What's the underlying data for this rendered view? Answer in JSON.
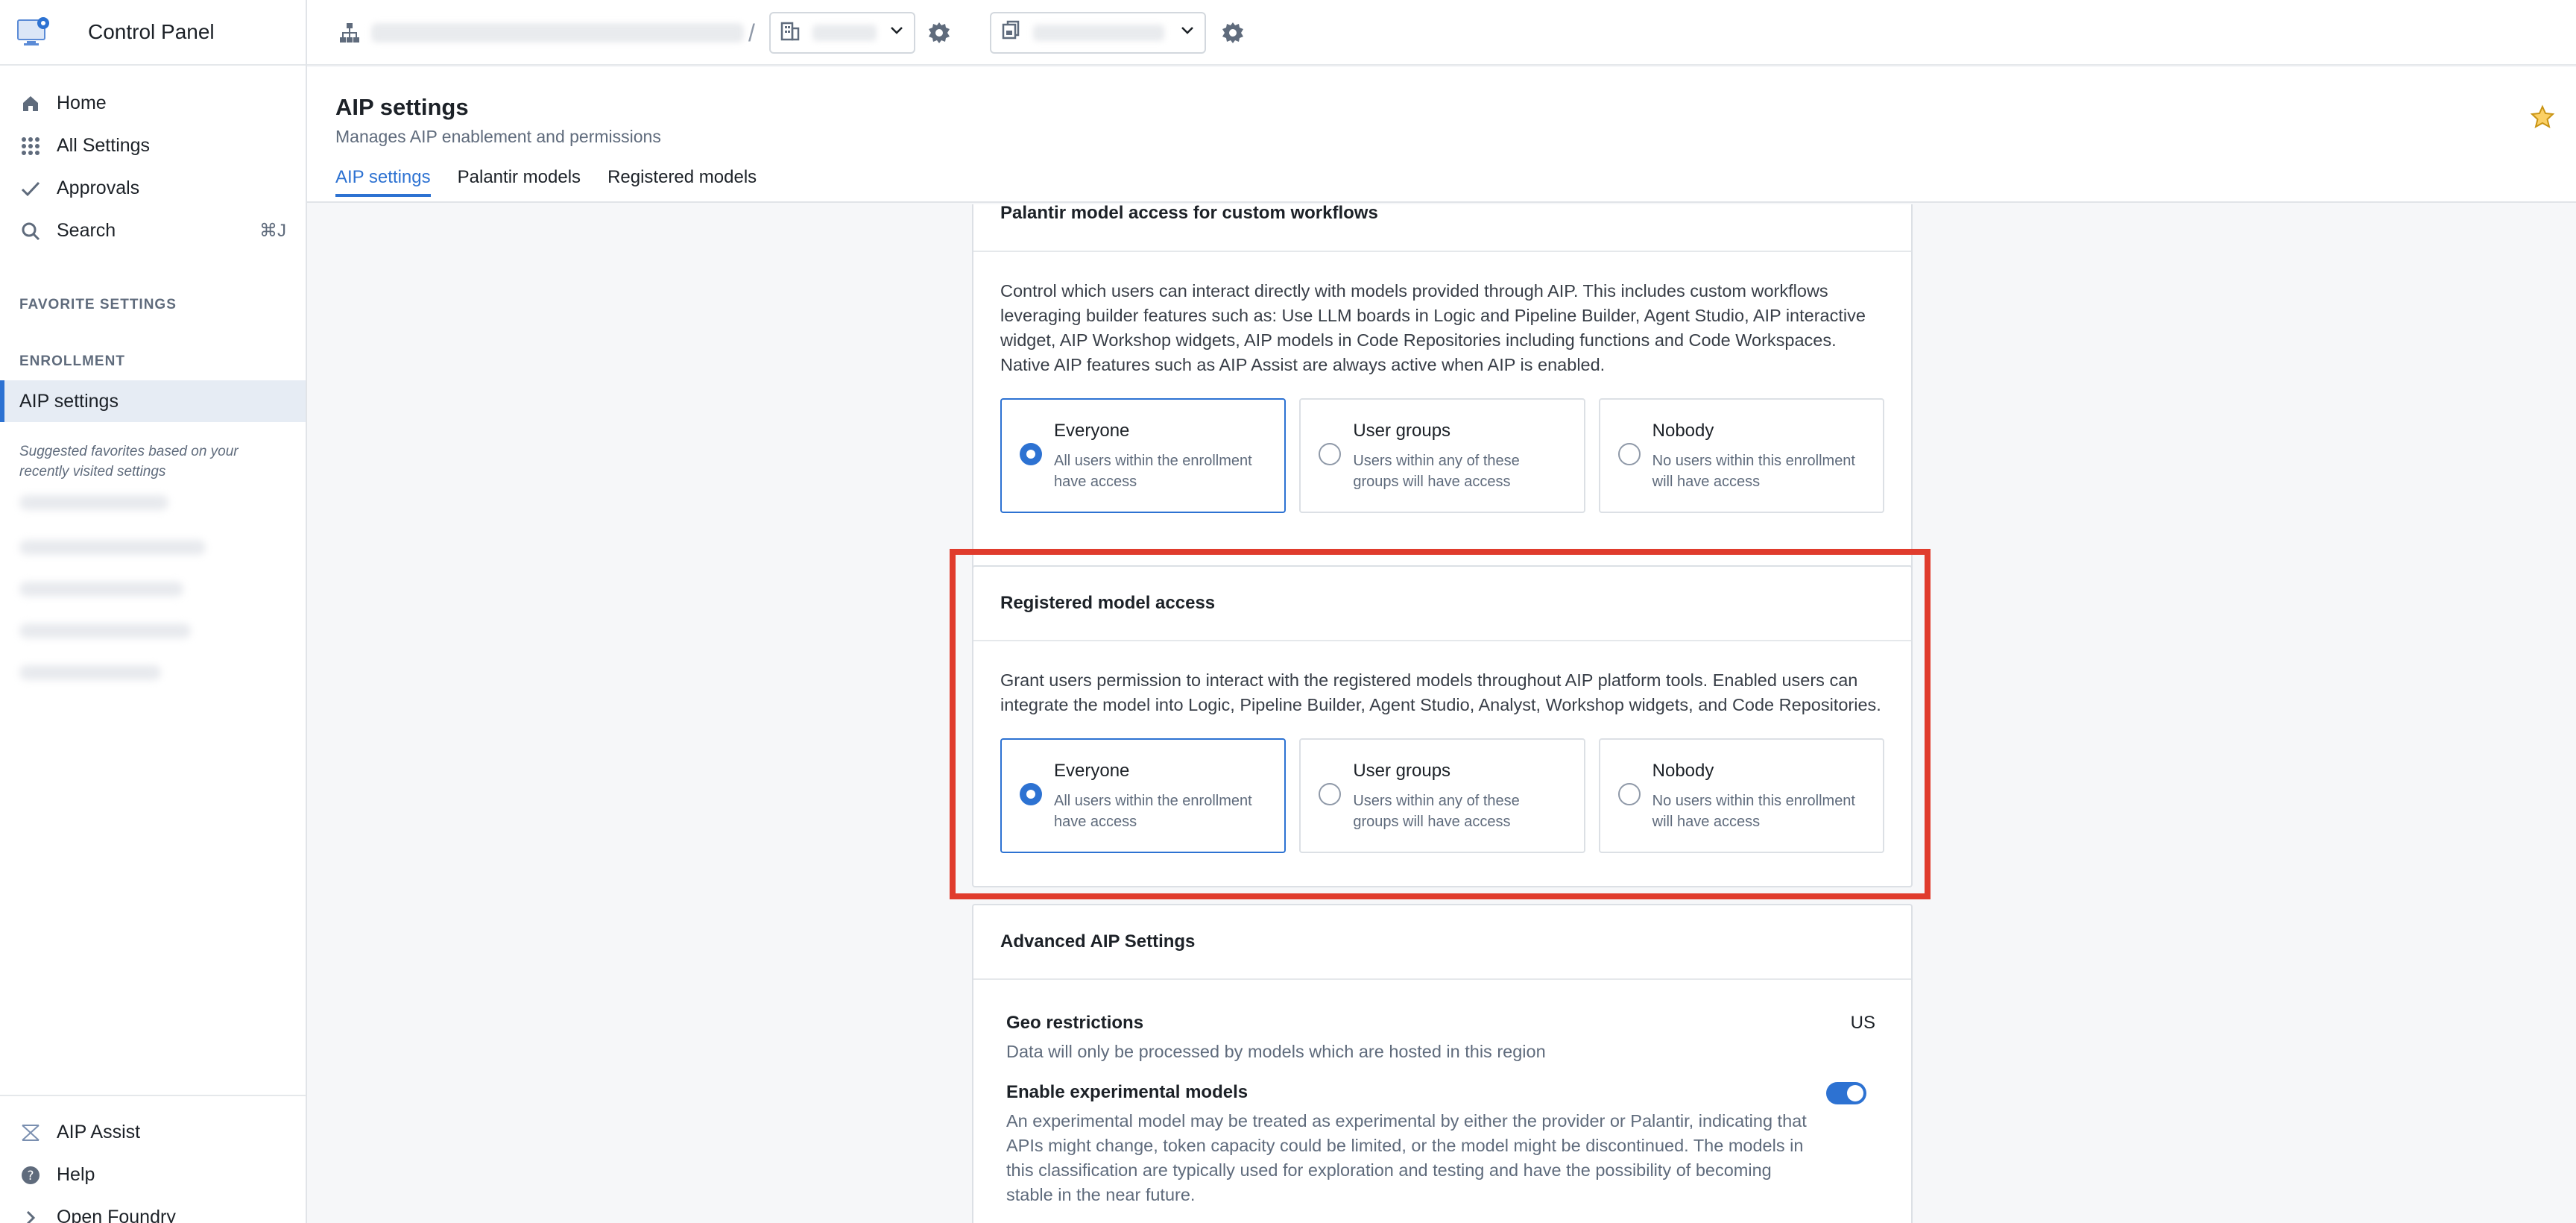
{
  "app": {
    "title": "Control Panel"
  },
  "sidebar": {
    "nav": [
      {
        "label": "Home",
        "icon": "home-icon"
      },
      {
        "label": "All Settings",
        "icon": "grid-icon"
      },
      {
        "label": "Approvals",
        "icon": "check-icon"
      },
      {
        "label": "Search",
        "icon": "search-icon",
        "shortcut": "⌘J"
      }
    ],
    "favorites_label": "FAVORITE SETTINGS",
    "enrollment_label": "ENROLLMENT",
    "active_item": "AIP settings",
    "suggested_text": "Suggested favorites based on your recently visited settings",
    "bottom": [
      {
        "label": "AIP Assist",
        "icon": "aip-assist-icon"
      },
      {
        "label": "Help",
        "icon": "help-icon"
      },
      {
        "label": "Open Foundry",
        "icon": "chevron-right-icon"
      }
    ]
  },
  "topbar": {
    "separator": "/"
  },
  "page": {
    "title": "AIP settings",
    "subtitle": "Manages AIP enablement and permissions",
    "tabs": [
      "AIP settings",
      "Palantir models",
      "Registered models"
    ],
    "active_tab": 0
  },
  "cards": {
    "palantir": {
      "title": "Palantir model access for custom workflows",
      "description": "Control which users can interact directly with models provided through AIP. This includes custom workflows leveraging builder features such as: Use LLM boards in Logic and Pipeline Builder, Agent Studio, AIP interactive widget, AIP Workshop widgets, AIP models in Code Repositories including functions and Code Workspaces. Native AIP features such as AIP Assist are always active when AIP is enabled.",
      "selected": "Everyone"
    },
    "registered": {
      "title": "Registered model access",
      "description": "Grant users permission to interact with the registered models throughout AIP platform tools. Enabled users can integrate the model into Logic, Pipeline Builder, Agent Studio, Analyst, Workshop widgets, and Code Repositories.",
      "selected": "Everyone"
    },
    "options": [
      {
        "title": "Everyone",
        "desc": "All users within the enrollment have access"
      },
      {
        "title": "User groups",
        "desc": "Users within any of these groups will have access"
      },
      {
        "title": "Nobody",
        "desc": "No users within this enrollment will have access"
      }
    ],
    "advanced": {
      "title": "Advanced AIP Settings",
      "geo_title": "Geo restrictions",
      "geo_value": "US",
      "geo_desc": "Data will only be processed by models which are hosted in this region",
      "exp_title": "Enable experimental models",
      "exp_enabled": true,
      "exp_desc": "An experimental model may be treated as experimental by either the provider or Palantir, indicating that APIs might change, token capacity could be limited, or the model might be discontinued. The models in this classification are typically used for exploration and testing and have the possibility of becoming stable in the near future."
    }
  },
  "colors": {
    "accent": "#2d72d2",
    "highlight": "#e03c2d"
  }
}
